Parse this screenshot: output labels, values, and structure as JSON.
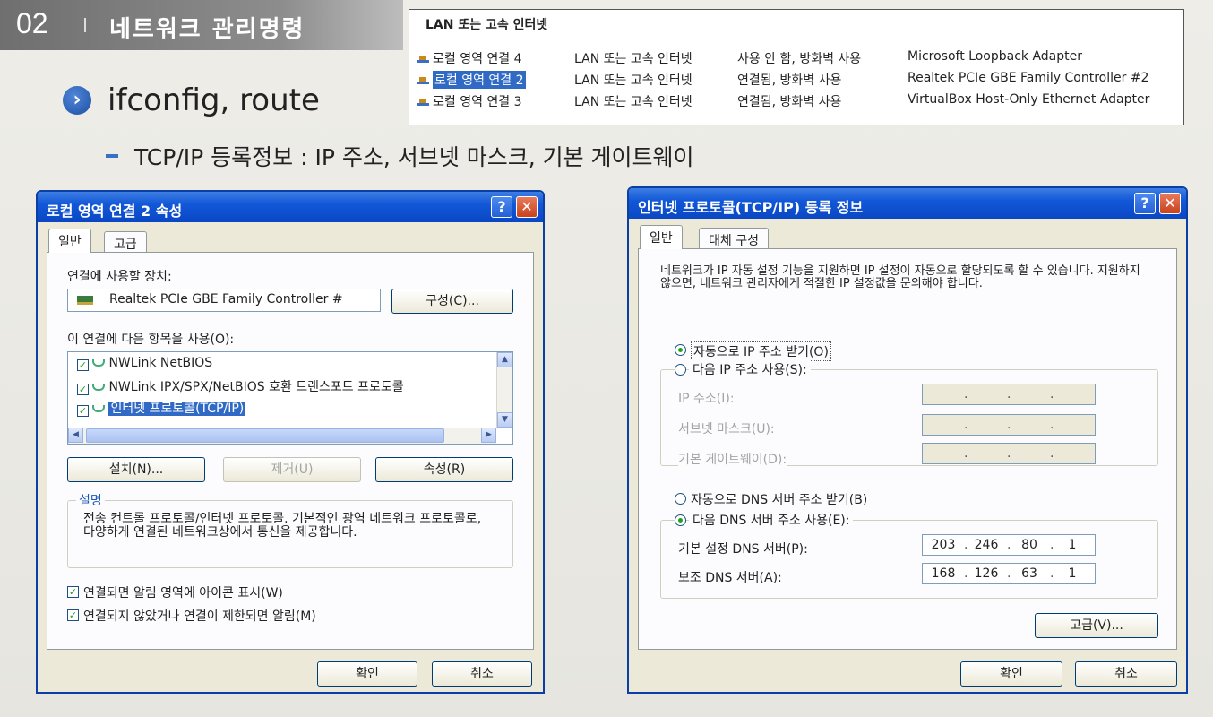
{
  "header": {
    "number": "02",
    "title": "네트워크 관리명령"
  },
  "bullet": {
    "text": "ifconfig, route",
    "sub": "TCP/IP 등록정보 : IP 주소, 서브넷 마스크, 기본 게이트웨이"
  },
  "lan_panel": {
    "title": "LAN 또는 고속 인터넷",
    "rows": [
      {
        "name": "로컬 영역 연결 4",
        "type": "LAN 또는 고속 인터넷",
        "status": "사용 안 함, 방화벽 사용",
        "device": "Microsoft Loopback Adapter"
      },
      {
        "name": "로컬 영역 연결 2",
        "type": "LAN 또는 고속 인터넷",
        "status": "연결됨, 방화벽 사용",
        "device": "Realtek PCIe GBE Family Controller #2"
      },
      {
        "name": "로컬 영역 연결 3",
        "type": "LAN 또는 고속 인터넷",
        "status": "연결됨, 방화벽 사용",
        "device": "VirtualBox Host-Only Ethernet Adapter"
      }
    ]
  },
  "dlg1": {
    "title": "로컬 영역 연결 2 속성",
    "tabs": [
      "일반",
      "고급"
    ],
    "device_label": "연결에 사용할 장치:",
    "device_value": "Realtek PCIe GBE Family Controller #",
    "config_button": "구성(C)...",
    "items_label": "이 연결에 다음 항목을 사용(O):",
    "items": [
      "NWLink NetBIOS",
      "NWLink IPX/SPX/NetBIOS 호환 트랜스포트 프로토콜",
      "인터넷 프로토콜(TCP/IP)"
    ],
    "install_button": "설치(N)...",
    "remove_button": "제거(U)",
    "properties_button": "속성(R)",
    "desc_title": "설명",
    "desc_text": "전송 컨트롤 프로토콜/인터넷 프로토콜. 기본적인 광역 네트워크 프로토콜로, 다양하게 연결된 네트워크상에서 통신을 제공합니다.",
    "check1": "연결되면 알림 영역에 아이콘 표시(W)",
    "check2": "연결되지 않았거나 연결이 제한되면 알림(M)",
    "ok": "확인",
    "cancel": "취소"
  },
  "dlg2": {
    "title": "인터넷 프로토콜(TCP/IP) 등록 정보",
    "tabs": [
      "일반",
      "대체 구성"
    ],
    "info": "네트워크가 IP 자동 설정 기능을 지원하면 IP 설정이 자동으로 할당되도록 할 수 있습니다. 지원하지 않으면, 네트워크 관리자에게 적절한 IP 설정값을 문의해야 합니다.",
    "auto_ip": "자동으로 IP 주소 받기(O)",
    "manual_ip": "다음 IP 주소 사용(S):",
    "ip_label": "IP 주소(I):",
    "mask_label": "서브넷 마스크(U):",
    "gw_label": "기본 게이트웨이(D):",
    "auto_dns": "자동으로 DNS 서버 주소 받기(B)",
    "manual_dns": "다음 DNS 서버 주소 사용(E):",
    "dns1_label": "기본 설정 DNS 서버(P):",
    "dns2_label": "보조 DNS 서버(A):",
    "dns1": [
      "203",
      "246",
      "80",
      "1"
    ],
    "dns2": [
      "168",
      "126",
      "63",
      "1"
    ],
    "advanced_button": "고급(V)...",
    "ok": "확인",
    "cancel": "취소"
  },
  "colors": {
    "titlebar": "#0a47c4",
    "selection": "#316ac5",
    "dialog_bg": "#ece9d8"
  }
}
